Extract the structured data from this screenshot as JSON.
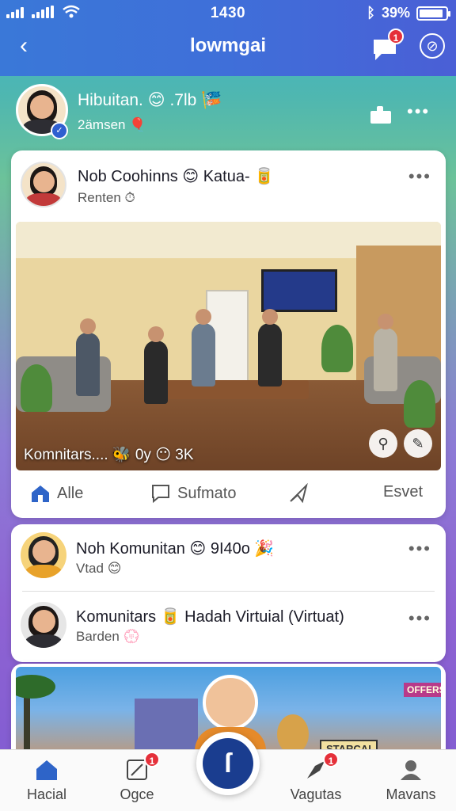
{
  "status": {
    "time": "1430",
    "battery": "39%",
    "battery_level": 0.8
  },
  "header": {
    "title": "lowmgai",
    "chat_badge": "1"
  },
  "profile": {
    "name": "Hibuitan. 😊 .7lb 🎏",
    "sub": "2ämsen 🎈"
  },
  "posts": [
    {
      "author": "Nob Coohinns 😊 Katua- 🥫",
      "sub": "Renten ⏱",
      "caption": "Komnitars.... 🐝 0y 😶 3K",
      "actions": [
        "Alle",
        "Sufmato",
        "",
        "Esvet"
      ]
    },
    {
      "author": "Noh Komunitan 😊 9I40o 🎉",
      "sub": "Vtad 😊"
    },
    {
      "author": "Komunitars 🥫 Hadah Virtuial (Virtuat)",
      "sub": "Barden 💮"
    }
  ],
  "banner": {
    "sign": "STARCAI",
    "neon": "OFFERS"
  },
  "nav": [
    {
      "label": "Hacial",
      "badge": ""
    },
    {
      "label": "Ogce",
      "badge": "1"
    },
    {
      "label": "Vagutas",
      "badge": "1"
    },
    {
      "label": "Mavans",
      "badge": ""
    }
  ],
  "colors": {
    "header": "#3f6fd9",
    "fab": "#1a3d8f",
    "badge": "#e5303a"
  }
}
